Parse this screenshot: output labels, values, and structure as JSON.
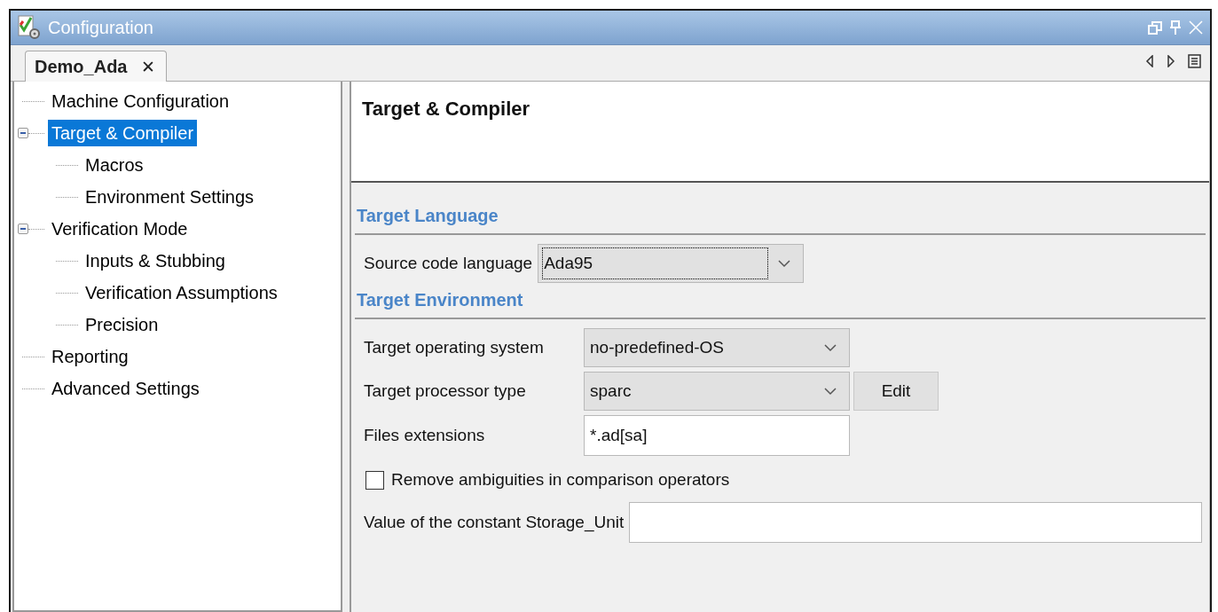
{
  "window": {
    "title": "Configuration"
  },
  "tabs": [
    {
      "label": "Demo_Ada",
      "close": "✕",
      "selected": true
    }
  ],
  "tree": [
    {
      "label": "Machine Configuration",
      "selected": false
    },
    {
      "label": "Target & Compiler",
      "selected": true,
      "expanded": true,
      "children": [
        {
          "label": "Macros",
          "selected": false
        },
        {
          "label": "Environment Settings",
          "selected": false
        }
      ]
    },
    {
      "label": "Verification Mode",
      "selected": false,
      "expanded": true,
      "children": [
        {
          "label": "Inputs & Stubbing",
          "selected": false
        },
        {
          "label": "Verification Assumptions",
          "selected": false
        },
        {
          "label": "Precision",
          "selected": false
        }
      ]
    },
    {
      "label": "Reporting",
      "selected": false
    },
    {
      "label": "Advanced Settings",
      "selected": false
    }
  ],
  "panel": {
    "title": "Target & Compiler",
    "sections": [
      {
        "heading": "Target Language",
        "rows": [
          {
            "kind": "dropdown",
            "label": "Source code language",
            "value": "Ada95",
            "focused": true
          }
        ]
      },
      {
        "heading": "Target Environment",
        "rows": [
          {
            "kind": "dropdown",
            "label": "Target operating system",
            "value": "no-predefined-OS",
            "focused": false
          },
          {
            "kind": "dropdown",
            "label": "Target processor type",
            "value": "sparc",
            "focused": false,
            "button": "Edit"
          },
          {
            "kind": "field",
            "label": "Files extensions",
            "value": "*.ad[sa]"
          },
          {
            "kind": "checkbox",
            "label": "Remove ambiguities in comparison operators",
            "checked": false
          },
          {
            "kind": "wide-field",
            "label": "Value of the constant Storage_Unit"
          }
        ]
      }
    ]
  }
}
